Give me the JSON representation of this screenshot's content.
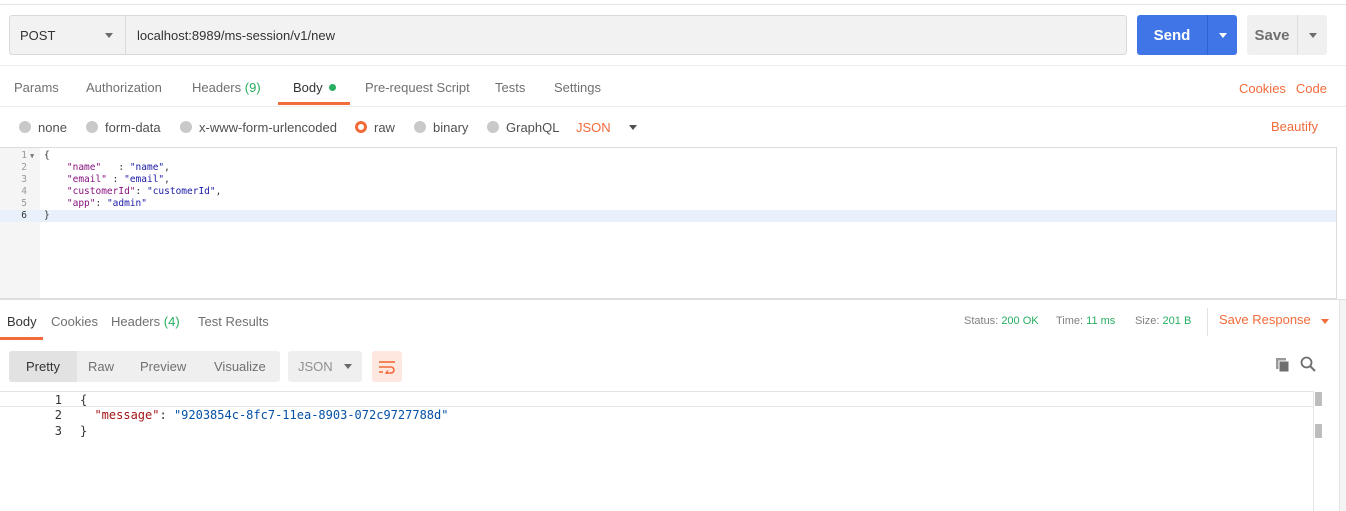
{
  "request": {
    "method": "POST",
    "url": "localhost:8989/ms-session/v1/new",
    "send_label": "Send",
    "save_label": "Save"
  },
  "request_tabs": [
    {
      "label": "Params"
    },
    {
      "label": "Authorization"
    },
    {
      "label": "Headers",
      "count": "(9)"
    },
    {
      "label": "Body"
    },
    {
      "label": "Pre-request Script"
    },
    {
      "label": "Tests"
    },
    {
      "label": "Settings"
    }
  ],
  "links": {
    "cookies": "Cookies",
    "code": "Code"
  },
  "body_types": [
    {
      "label": "none"
    },
    {
      "label": "form-data"
    },
    {
      "label": "x-www-form-urlencoded"
    },
    {
      "label": "raw"
    },
    {
      "label": "binary"
    },
    {
      "label": "GraphQL"
    }
  ],
  "raw_format": "JSON",
  "beautify_label": "Beautify",
  "editor": {
    "line_numbers": [
      "1",
      "2",
      "3",
      "4",
      "5",
      "6"
    ],
    "lines": [
      {
        "p1": "{"
      },
      {
        "p1": "    ",
        "key": "\"name\"",
        "p2": "   : ",
        "val": "\"name\"",
        "p3": ","
      },
      {
        "p1": "    ",
        "key": "\"email\"",
        "p2": " : ",
        "val": "\"email\"",
        "p3": ","
      },
      {
        "p1": "    ",
        "key": "\"customerId\"",
        "p2": ": ",
        "val": "\"customerId\"",
        "p3": ","
      },
      {
        "p1": "    ",
        "key": "\"app\"",
        "p2": ": ",
        "val": "\"admin\"",
        "p3": ""
      },
      {
        "p1": "}"
      }
    ]
  },
  "response_tabs": [
    {
      "label": "Body"
    },
    {
      "label": "Cookies"
    },
    {
      "label": "Headers",
      "count": "(4)"
    },
    {
      "label": "Test Results"
    }
  ],
  "status": {
    "status_label": "Status:",
    "status_value": "200 OK",
    "time_label": "Time:",
    "time_value": "11 ms",
    "size_label": "Size:",
    "size_value": "201 B"
  },
  "save_response_label": "Save Response",
  "view_modes": [
    "Pretty",
    "Raw",
    "Preview",
    "Visualize"
  ],
  "response_format": "JSON",
  "response_body": {
    "line_numbers": [
      "1",
      "2",
      "3"
    ],
    "open": "{",
    "key": "\"message\"",
    "sep": ": ",
    "value": "\"9203854c-8fc7-11ea-8903-072c9727788d\"",
    "close": "}"
  },
  "colors": {
    "accent": "#f26b3a",
    "send": "#3f75e6",
    "success": "#27ae60"
  }
}
